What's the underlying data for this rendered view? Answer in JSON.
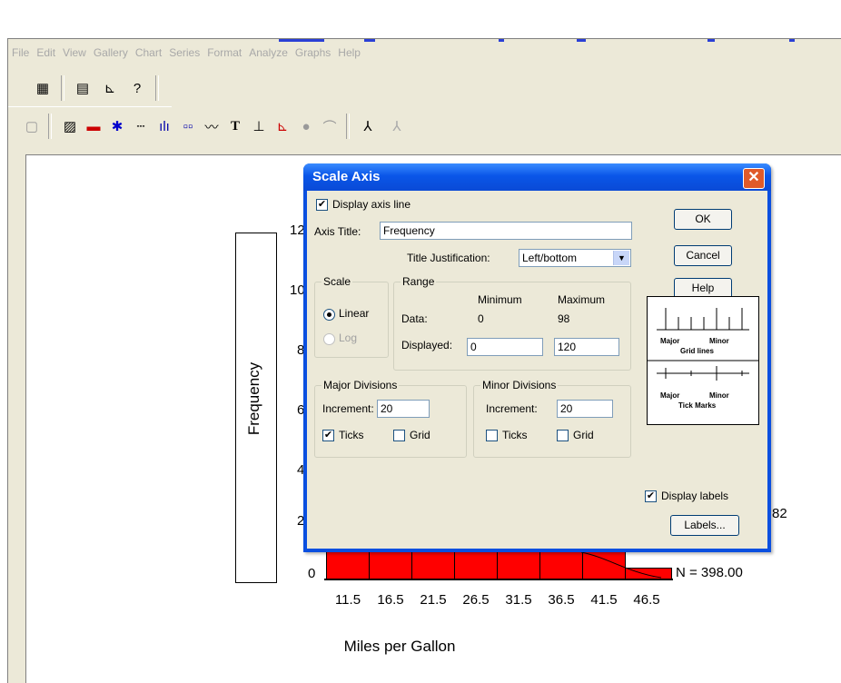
{
  "menu": [
    "File",
    "Edit",
    "View",
    "Gallery",
    "Chart",
    "Series",
    "Format",
    "Analyze",
    "Graphs",
    "Help"
  ],
  "chart": {
    "y_axis_title": "Frequency",
    "y_ticks": [
      "12",
      "10",
      "8",
      "6",
      "4",
      "2",
      "0"
    ],
    "x_ticks": [
      "11.5",
      "16.5",
      "21.5",
      "26.5",
      "31.5",
      "36.5",
      "41.5",
      "46.5"
    ],
    "x_axis_title": "Miles per Gallon",
    "stat_partial": "82",
    "stat_n": "N = 398.00"
  },
  "chart_data": {
    "type": "bar",
    "categories": [
      "11.5",
      "16.5",
      "21.5",
      "26.5",
      "31.5",
      "36.5",
      "41.5",
      "46.5"
    ],
    "xlabel": "Miles per Gallon",
    "ylabel": "Frequency",
    "ylim": [
      0,
      120
    ]
  },
  "dialog": {
    "title": "Scale Axis",
    "display_axis_line": "Display axis line",
    "axis_title_label": "Axis Title:",
    "axis_title_value": "Frequency",
    "title_justification_label": "Title Justification:",
    "title_justification_value": "Left/bottom",
    "scale_group": "Scale",
    "scale_linear": "Linear",
    "scale_log": "Log",
    "range_group": "Range",
    "minimum": "Minimum",
    "maximum": "Maximum",
    "data_label": "Data:",
    "data_min": "0",
    "data_max": "98",
    "displayed_label": "Displayed:",
    "displayed_min": "0",
    "displayed_max": "120",
    "major_group": "Major Divisions",
    "minor_group": "Minor Divisions",
    "increment_label": "Increment:",
    "major_increment": "20",
    "minor_increment": "20",
    "ticks": "Ticks",
    "grid": "Grid",
    "display_labels": "Display labels",
    "ok": "OK",
    "cancel": "Cancel",
    "help": "Help",
    "labels_btn": "Labels...",
    "preview": {
      "major": "Major",
      "minor": "Minor",
      "grid_lines": "Grid lines",
      "tick_marks": "Tick Marks"
    }
  }
}
